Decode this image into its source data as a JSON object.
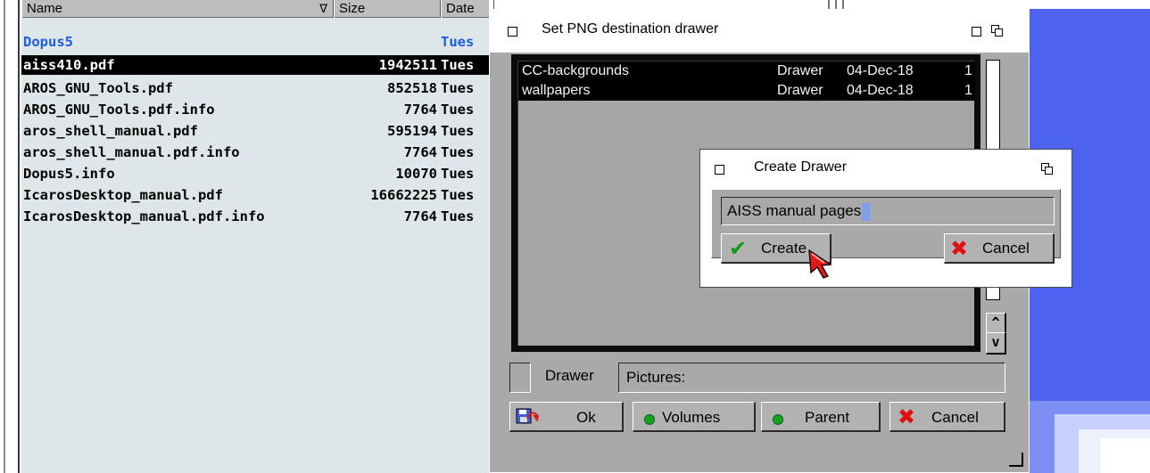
{
  "lister": {
    "columns": {
      "name": "Name",
      "size": "Size",
      "date": "Date"
    },
    "rows": [
      {
        "name": "Dopus5",
        "size": "",
        "date": "Tues",
        "dir": true
      },
      {
        "name": "aiss410.pdf",
        "size": "1942511",
        "date": "Tues",
        "selected": true
      },
      {
        "name": "AROS_GNU_Tools.pdf",
        "size": "852518",
        "date": "Tues"
      },
      {
        "name": "AROS_GNU_Tools.pdf.info",
        "size": "7764",
        "date": "Tues"
      },
      {
        "name": "aros_shell_manual.pdf",
        "size": "595194",
        "date": "Tues"
      },
      {
        "name": "aros_shell_manual.pdf.info",
        "size": "7764",
        "date": "Tues"
      },
      {
        "name": "Dopus5.info",
        "size": "10070",
        "date": "Tues"
      },
      {
        "name": "IcarosDesktop_manual.pdf",
        "size": "16662225",
        "date": "Tues"
      },
      {
        "name": "IcarosDesktop_manual.pdf.info",
        "size": "7764",
        "date": "Tues"
      }
    ]
  },
  "png_requester": {
    "title": "Set PNG destination drawer",
    "entries": [
      {
        "name": "CC-backgrounds",
        "type": "Drawer",
        "date": "04-Dec-18",
        "count": "1"
      },
      {
        "name": "wallpapers",
        "type": "Drawer",
        "date": "04-Dec-18",
        "count": "1"
      }
    ],
    "scroll_up": "^",
    "scroll_down": "v",
    "drawer_label": "Drawer",
    "drawer_value": "Pictures:",
    "buttons": {
      "ok": "Ok",
      "volumes": "Volumes",
      "parent": "Parent",
      "cancel": "Cancel"
    }
  },
  "create_drawer": {
    "title": "Create Drawer",
    "input_value": "AISS manual pages",
    "create_label": "Create",
    "cancel_label": "Cancel"
  },
  "colors": {
    "lister_bg": "#dfe6e9",
    "directory_text": "#1a5fd9",
    "selection": "#000000",
    "window_gray": "#a9a9a9",
    "desktop_blue": "#4d63f0",
    "go_green": "#1aa11a",
    "cancel_red": "#e01010"
  }
}
